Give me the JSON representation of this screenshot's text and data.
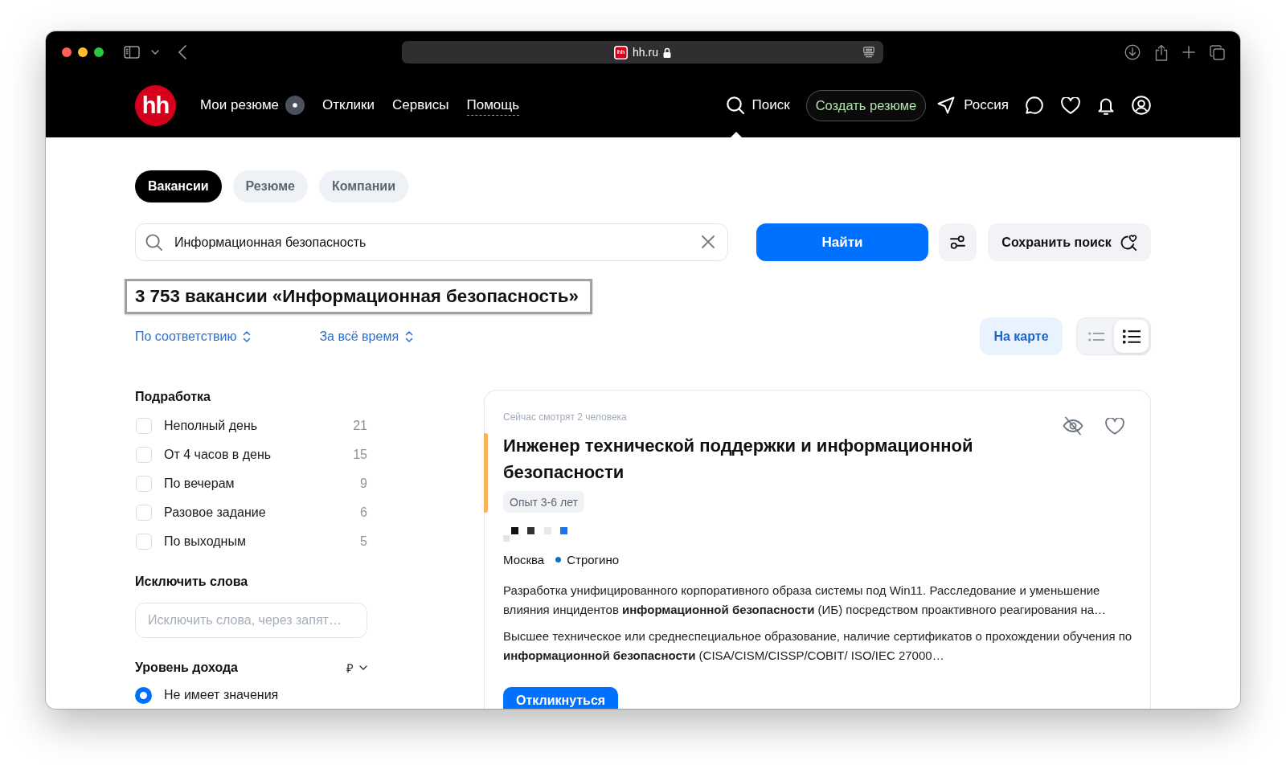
{
  "browser": {
    "favicon_text": "hh",
    "url": "hh.ru"
  },
  "header": {
    "logo_text": "hh",
    "nav": [
      {
        "label": "Мои резюме",
        "kind": "link",
        "badge": true
      },
      {
        "label": "Отклики",
        "kind": "link",
        "badge": false
      },
      {
        "label": "Сервисы",
        "kind": "link",
        "badge": false
      },
      {
        "label": "Помощь",
        "kind": "menu",
        "badge": false
      }
    ],
    "search": {
      "label": "Поиск",
      "selected": true
    },
    "create_button": "Создать резюме",
    "region": "Россия"
  },
  "search_tabs": [
    {
      "label": "Вакансии",
      "selected": true
    },
    {
      "label": "Резюме",
      "selected": false
    },
    {
      "label": "Компании",
      "selected": false
    }
  ],
  "search": {
    "value": "Информационная безопасность",
    "submit": "Найти",
    "save": "Сохранить поиск"
  },
  "results": {
    "heading": "3 753 вакансии «Информационная безопасность»",
    "heading_focused": true,
    "sort": [
      {
        "label": "По соответствию"
      },
      {
        "label": "За всё время"
      }
    ],
    "map_button": "На карте",
    "views": [
      {
        "kind": "compact",
        "selected": false
      },
      {
        "kind": "detailed",
        "selected": true
      }
    ]
  },
  "filters": {
    "part_time": {
      "title": "Подработка",
      "options": [
        {
          "label": "Неполный день",
          "count": "21",
          "checked": false
        },
        {
          "label": "От 4 часов в день",
          "count": "15",
          "checked": false
        },
        {
          "label": "По вечерам",
          "count": "9",
          "checked": false
        },
        {
          "label": "Разовое задание",
          "count": "6",
          "checked": false
        },
        {
          "label": "По выходным",
          "count": "5",
          "checked": false
        }
      ]
    },
    "exclude": {
      "title": "Исключить слова",
      "placeholder": "Исключить слова, через запят…"
    },
    "income": {
      "title": "Уровень дохода",
      "currency": "₽",
      "options": [
        {
          "label": "Не имеет значения",
          "selected": true
        }
      ]
    }
  },
  "vacancy": {
    "viewers": "Сейчас смотрят 2 человека",
    "title": "Инженер технической поддержки и информационной безопасности",
    "accent_bar": true,
    "experience": "Опыт 3-6 лет",
    "city": "Москва",
    "metro": {
      "name": "Строгино",
      "color": "#0078c9"
    },
    "snippets": [
      "Разработка унифицированного корпоративного образа системы под Win11. Расследование и уменьшение влияния инцидентов **информационной безопасности** (ИБ) посредством проактивного реагирования на…",
      "Высшее техническое или среднеспециальное образование, наличие сертификатов о прохождении обучения по **информационной безопасности** (CISA/CISM/CISSP/COBIT/ ISO/IEC 27000…"
    ],
    "apply_button": "Откликнуться"
  }
}
